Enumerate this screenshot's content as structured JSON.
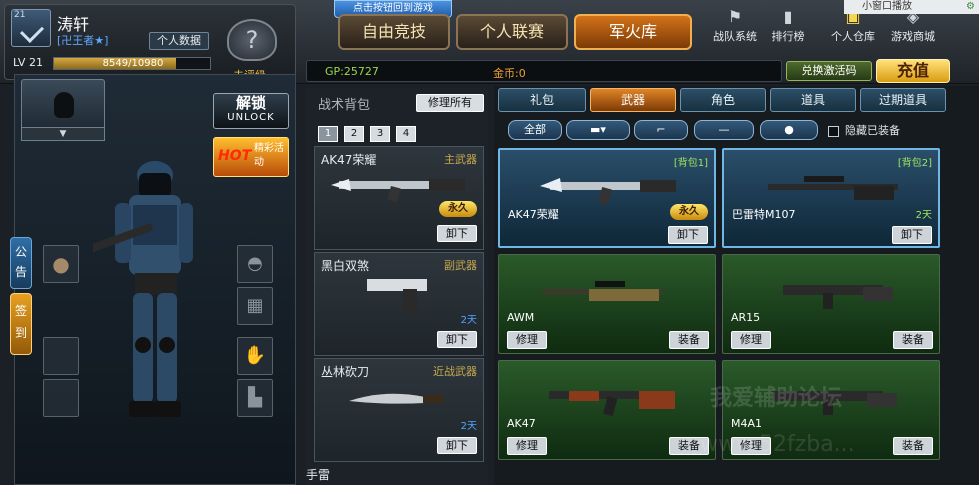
{
  "window": {
    "mini_label": "小窗口播放"
  },
  "hint": "点击按钮回到游戏",
  "profile": {
    "name": "涛轩",
    "tag": "[卍王者★]",
    "personal_btn": "个人数据",
    "level": "LV 21",
    "exp": "8549/10980",
    "exp_fraction": 0.779,
    "rank_label": "未评级",
    "rank_badge": "21"
  },
  "main_tabs": [
    {
      "label": "自由竞技"
    },
    {
      "label": "个人联赛"
    },
    {
      "label": "军火库"
    }
  ],
  "nav": [
    {
      "label": "战队系统",
      "icon": "clan-icon"
    },
    {
      "label": "排行榜",
      "icon": "ranking-icon"
    },
    {
      "label": "个人仓库",
      "icon": "warehouse-icon"
    },
    {
      "label": "游戏商城",
      "icon": "shop-icon"
    }
  ],
  "currency": {
    "gp": "GP:25727",
    "gold": "金币:0",
    "redeem": "兑换激活码",
    "recharge": "充值"
  },
  "left": {
    "unlock_cn": "解锁",
    "unlock_en": "UNLOCK",
    "hot": "HOT",
    "hot_text": "精彩活动",
    "notice": "公告",
    "signin": "签到"
  },
  "bag": {
    "title": "战术背包",
    "repair_all": "修理所有",
    "pages": [
      "1",
      "2",
      "3",
      "4"
    ],
    "slots": [
      {
        "name": "AK47荣耀",
        "category": "主武器",
        "badge": "永久",
        "action": "卸下"
      },
      {
        "name": "黑白双煞",
        "category": "副武器",
        "time": "2天",
        "action": "卸下"
      },
      {
        "name": "丛林砍刀",
        "category": "近战武器",
        "time": "2天",
        "action": "卸下"
      }
    ],
    "grenade": "手雷"
  },
  "store": {
    "tabs": [
      "礼包",
      "武器",
      "角色",
      "道具",
      "过期道具"
    ],
    "filter_all": "全部",
    "hide_equipped": "隐藏已装备",
    "cards": [
      {
        "name": "AK47荣耀",
        "bag": "[背包1]",
        "badge": "永久",
        "action": "卸下"
      },
      {
        "name": "巴雷特M107",
        "bag": "[背包2]",
        "time": "2天",
        "action": "卸下"
      },
      {
        "name": "AWM",
        "repair": "修理",
        "action": "装备"
      },
      {
        "name": "AR15",
        "repair": "修理",
        "action": "装备"
      },
      {
        "name": "AK47",
        "repair": "修理",
        "action": "装备"
      },
      {
        "name": "M4A1",
        "repair": "修理",
        "action": "装备"
      }
    ]
  },
  "watermark": "我爱辅助论坛",
  "watermark_url": "www.52fzba..."
}
